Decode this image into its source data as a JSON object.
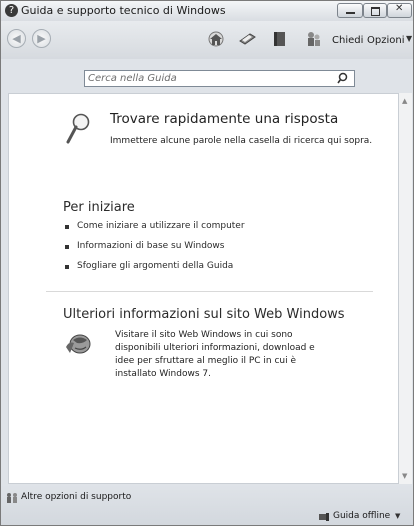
{
  "window": {
    "title": "Guida e supporto tecnico di Windows"
  },
  "toolbar": {
    "home_icon": "home-icon",
    "print_icon": "print-icon",
    "browse_icon": "browse-help-icon",
    "ask_icon": "ask-people-icon",
    "ask_label": "Chiedi",
    "options_label": "Opzioni"
  },
  "search": {
    "placeholder": "Cerca nella Guida"
  },
  "quick": {
    "title": "Trovare rapidamente una risposta",
    "desc": "Immettere alcune parole nella casella di ricerca qui sopra."
  },
  "getting_started": {
    "title": "Per iniziare",
    "items": [
      "Come iniziare a utilizzare il computer",
      "Informazioni di base su Windows",
      "Sfogliare gli argomenti della Guida"
    ]
  },
  "web": {
    "title": "Ulteriori informazioni sul sito Web Windows",
    "desc": "Visitare il sito Web Windows in cui sono disponibili ulteriori informazioni, download e idee per sfruttare al meglio il PC in cui è installato Windows 7."
  },
  "status": {
    "support_label": "Altre opzioni di supporto",
    "offline_label": "Guida offline"
  }
}
